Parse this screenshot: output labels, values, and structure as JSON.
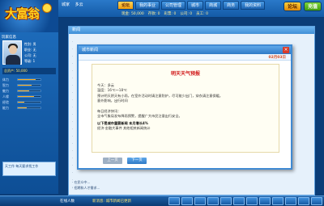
{
  "header": {
    "logo_text": "大富翁",
    "weather_label": "城家",
    "weather_value": "多云",
    "nav": [
      "论坛",
      "我的事业",
      "公司管理",
      "城市",
      "商城",
      "商务",
      "我的资料"
    ],
    "stats": [
      "现金: 50,000",
      "存款: 0",
      "彩票: 0",
      "公司: 0",
      "员工: 0"
    ],
    "forum_btn": "论坛",
    "recharge_btn": "充值"
  },
  "left_panel": {
    "profile_title": "玩家信息",
    "info_lines": [
      "性别: 男",
      "职业: 无",
      "公司: 无",
      "等级: 1"
    ],
    "asset_label": "总资产: 50,000",
    "stats": [
      {
        "label": "体力",
        "value": 0.8
      },
      {
        "label": "智力",
        "value": 0.6
      },
      {
        "label": "魅力",
        "value": 0.5
      },
      {
        "label": "人缘",
        "value": 0.7
      },
      {
        "label": "经验",
        "value": 0.3
      },
      {
        "label": "能力",
        "value": 0.4
      }
    ],
    "tip_text": "天工作 每天要求找工作"
  },
  "main_panel": {
    "title": "新闻",
    "side_lines": [
      "·",
      "·",
      "·",
      "·",
      "·",
      "·",
      "·",
      "·",
      "·",
      "·",
      "·",
      "·",
      "·",
      "·",
      "·",
      "·",
      "·",
      "·",
      "·",
      "·",
      "·"
    ],
    "foot_lines": [
      "· 在民众中...",
      "· 招聘和人才需求..."
    ]
  },
  "modal": {
    "title": "城市新闻",
    "close": "×",
    "date": "02月03日",
    "forecast_title": "明天天气预报",
    "lines": [
      "今天：多云",
      "温度：16℃～18℃",
      "预计明天阴天有小雨，在室外活动时请注意防护，尽可能少出门，穿衣请注意保暖。",
      "意外影响，出行时间",
      "",
      "每日经济快讯：",
      "全市气象局发布降雨预警，提醒广大市民注意出行安全。"
    ],
    "strong_line": "以下是城市重要新闻 本月增长4%",
    "more_lines": [
      "经济·金融大事件 其他相关新闻统计"
    ],
    "prev_label": "上一页",
    "next_label": "下一页"
  },
  "bottom": {
    "left_label": "在线人数",
    "news": "新消息: 城市新闻已更新"
  }
}
